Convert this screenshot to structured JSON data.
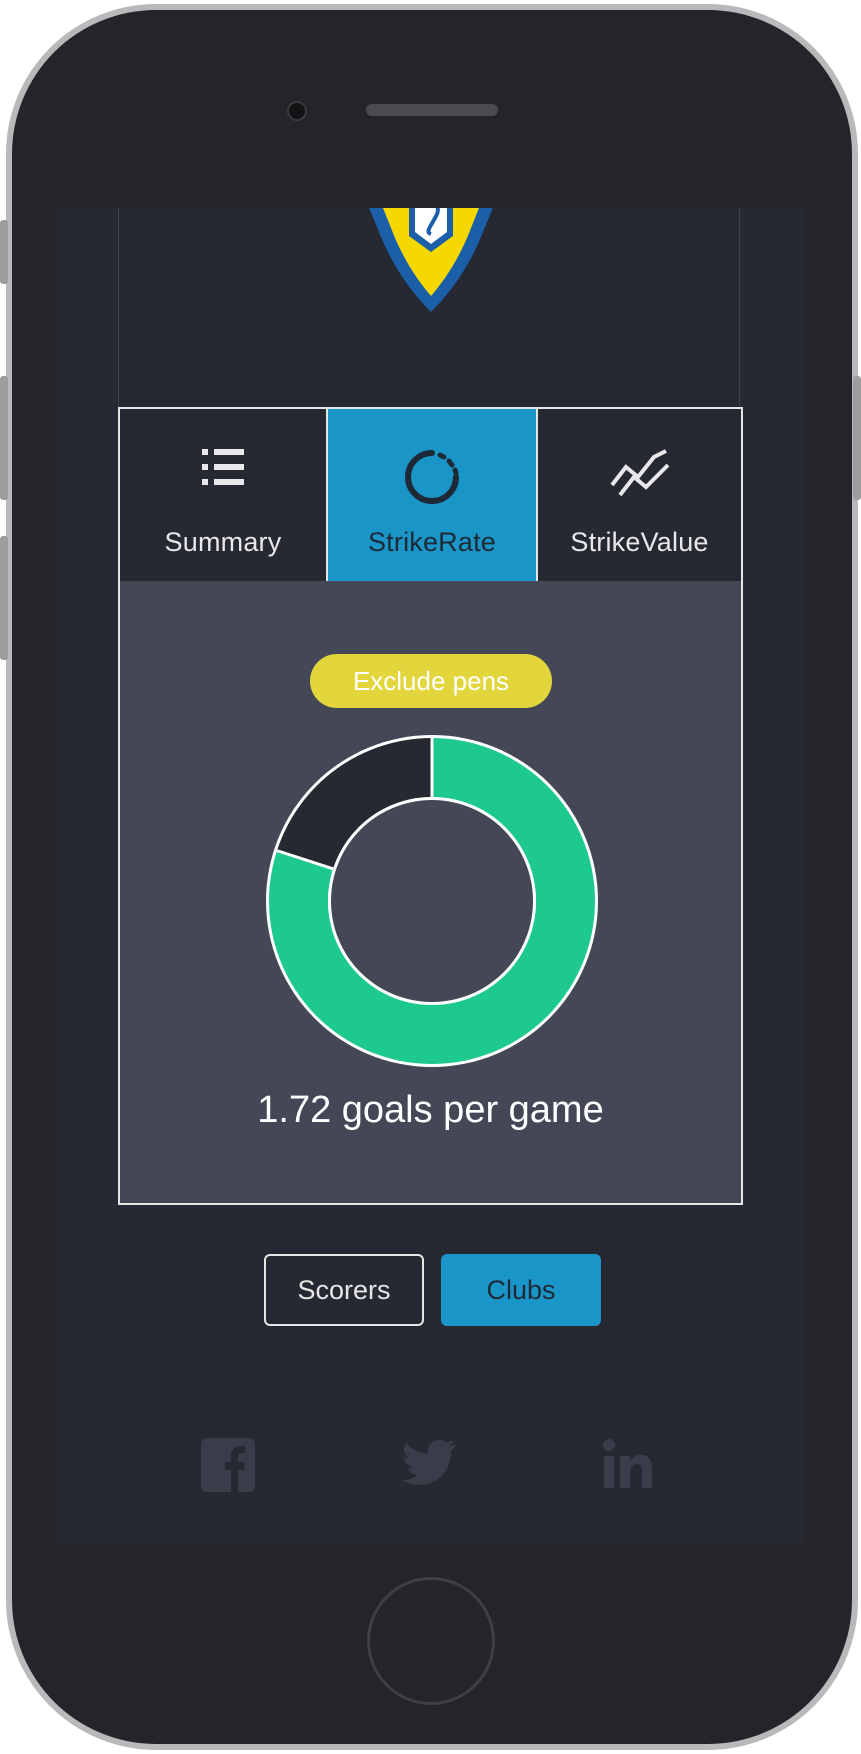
{
  "tabs": [
    {
      "label": "Summary",
      "icon": "list-icon",
      "active": false
    },
    {
      "label": "StrikeRate",
      "icon": "spinner-icon",
      "active": true
    },
    {
      "label": "StrikeValue",
      "icon": "line-chart-icon",
      "active": false
    }
  ],
  "pens_toggle": {
    "label": "Exclude pens"
  },
  "strike_rate": {
    "goals_text": "1.72 goals per game",
    "fill_fraction": 0.8
  },
  "mode_buttons": {
    "scorers": "Scorers",
    "clubs": "Clubs",
    "active": "clubs"
  },
  "social": [
    "facebook-icon",
    "twitter-icon",
    "linkedin-icon"
  ],
  "colors": {
    "accent": "#1a95c8",
    "ring_fill": "#1ec990",
    "ring_empty": "#262832",
    "toggle": "#e3d63c",
    "panel": "#444856",
    "background": "#262832",
    "crest_yellow": "#f5d800",
    "crest_blue": "#1a5fa8"
  }
}
